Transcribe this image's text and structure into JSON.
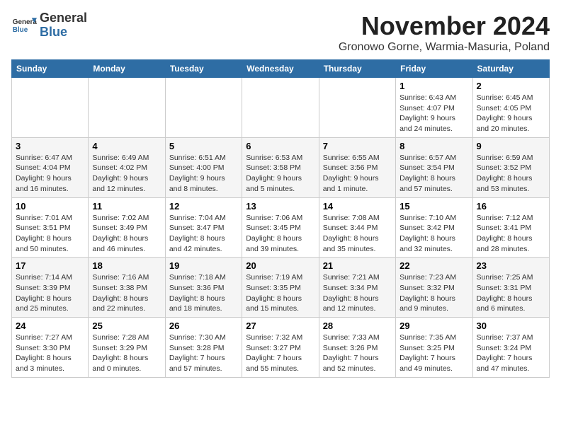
{
  "logo": {
    "general": "General",
    "blue": "Blue"
  },
  "title": "November 2024",
  "location": "Gronowo Gorne, Warmia-Masuria, Poland",
  "days_of_week": [
    "Sunday",
    "Monday",
    "Tuesday",
    "Wednesday",
    "Thursday",
    "Friday",
    "Saturday"
  ],
  "weeks": [
    [
      {
        "day": "",
        "info": ""
      },
      {
        "day": "",
        "info": ""
      },
      {
        "day": "",
        "info": ""
      },
      {
        "day": "",
        "info": ""
      },
      {
        "day": "",
        "info": ""
      },
      {
        "day": "1",
        "info": "Sunrise: 6:43 AM\nSunset: 4:07 PM\nDaylight: 9 hours and 24 minutes."
      },
      {
        "day": "2",
        "info": "Sunrise: 6:45 AM\nSunset: 4:05 PM\nDaylight: 9 hours and 20 minutes."
      }
    ],
    [
      {
        "day": "3",
        "info": "Sunrise: 6:47 AM\nSunset: 4:04 PM\nDaylight: 9 hours and 16 minutes."
      },
      {
        "day": "4",
        "info": "Sunrise: 6:49 AM\nSunset: 4:02 PM\nDaylight: 9 hours and 12 minutes."
      },
      {
        "day": "5",
        "info": "Sunrise: 6:51 AM\nSunset: 4:00 PM\nDaylight: 9 hours and 8 minutes."
      },
      {
        "day": "6",
        "info": "Sunrise: 6:53 AM\nSunset: 3:58 PM\nDaylight: 9 hours and 5 minutes."
      },
      {
        "day": "7",
        "info": "Sunrise: 6:55 AM\nSunset: 3:56 PM\nDaylight: 9 hours and 1 minute."
      },
      {
        "day": "8",
        "info": "Sunrise: 6:57 AM\nSunset: 3:54 PM\nDaylight: 8 hours and 57 minutes."
      },
      {
        "day": "9",
        "info": "Sunrise: 6:59 AM\nSunset: 3:52 PM\nDaylight: 8 hours and 53 minutes."
      }
    ],
    [
      {
        "day": "10",
        "info": "Sunrise: 7:01 AM\nSunset: 3:51 PM\nDaylight: 8 hours and 50 minutes."
      },
      {
        "day": "11",
        "info": "Sunrise: 7:02 AM\nSunset: 3:49 PM\nDaylight: 8 hours and 46 minutes."
      },
      {
        "day": "12",
        "info": "Sunrise: 7:04 AM\nSunset: 3:47 PM\nDaylight: 8 hours and 42 minutes."
      },
      {
        "day": "13",
        "info": "Sunrise: 7:06 AM\nSunset: 3:45 PM\nDaylight: 8 hours and 39 minutes."
      },
      {
        "day": "14",
        "info": "Sunrise: 7:08 AM\nSunset: 3:44 PM\nDaylight: 8 hours and 35 minutes."
      },
      {
        "day": "15",
        "info": "Sunrise: 7:10 AM\nSunset: 3:42 PM\nDaylight: 8 hours and 32 minutes."
      },
      {
        "day": "16",
        "info": "Sunrise: 7:12 AM\nSunset: 3:41 PM\nDaylight: 8 hours and 28 minutes."
      }
    ],
    [
      {
        "day": "17",
        "info": "Sunrise: 7:14 AM\nSunset: 3:39 PM\nDaylight: 8 hours and 25 minutes."
      },
      {
        "day": "18",
        "info": "Sunrise: 7:16 AM\nSunset: 3:38 PM\nDaylight: 8 hours and 22 minutes."
      },
      {
        "day": "19",
        "info": "Sunrise: 7:18 AM\nSunset: 3:36 PM\nDaylight: 8 hours and 18 minutes."
      },
      {
        "day": "20",
        "info": "Sunrise: 7:19 AM\nSunset: 3:35 PM\nDaylight: 8 hours and 15 minutes."
      },
      {
        "day": "21",
        "info": "Sunrise: 7:21 AM\nSunset: 3:34 PM\nDaylight: 8 hours and 12 minutes."
      },
      {
        "day": "22",
        "info": "Sunrise: 7:23 AM\nSunset: 3:32 PM\nDaylight: 8 hours and 9 minutes."
      },
      {
        "day": "23",
        "info": "Sunrise: 7:25 AM\nSunset: 3:31 PM\nDaylight: 8 hours and 6 minutes."
      }
    ],
    [
      {
        "day": "24",
        "info": "Sunrise: 7:27 AM\nSunset: 3:30 PM\nDaylight: 8 hours and 3 minutes."
      },
      {
        "day": "25",
        "info": "Sunrise: 7:28 AM\nSunset: 3:29 PM\nDaylight: 8 hours and 0 minutes."
      },
      {
        "day": "26",
        "info": "Sunrise: 7:30 AM\nSunset: 3:28 PM\nDaylight: 7 hours and 57 minutes."
      },
      {
        "day": "27",
        "info": "Sunrise: 7:32 AM\nSunset: 3:27 PM\nDaylight: 7 hours and 55 minutes."
      },
      {
        "day": "28",
        "info": "Sunrise: 7:33 AM\nSunset: 3:26 PM\nDaylight: 7 hours and 52 minutes."
      },
      {
        "day": "29",
        "info": "Sunrise: 7:35 AM\nSunset: 3:25 PM\nDaylight: 7 hours and 49 minutes."
      },
      {
        "day": "30",
        "info": "Sunrise: 7:37 AM\nSunset: 3:24 PM\nDaylight: 7 hours and 47 minutes."
      }
    ]
  ]
}
